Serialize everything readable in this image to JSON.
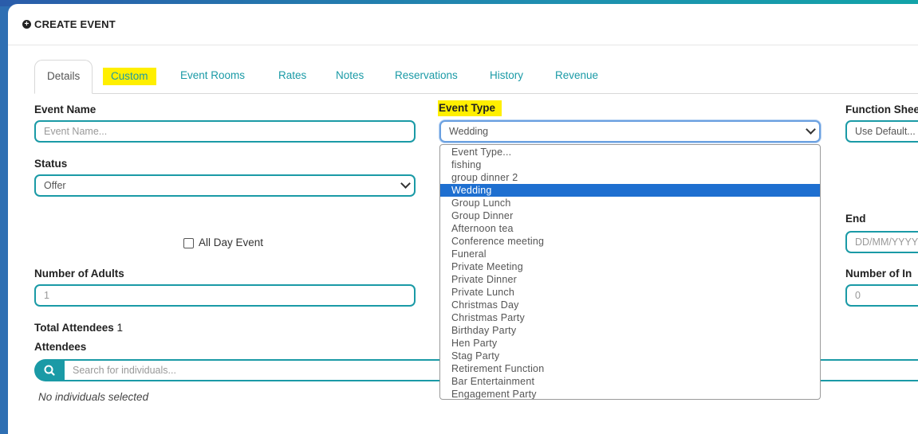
{
  "header": {
    "title": "CREATE EVENT"
  },
  "tabs": [
    "Details",
    "Custom",
    "Event Rooms",
    "Rates",
    "Notes",
    "Reservations",
    "History",
    "Revenue"
  ],
  "form": {
    "event_name": {
      "label": "Event Name",
      "placeholder": "Event Name..."
    },
    "event_type": {
      "label": "Event Type",
      "value": "Wedding"
    },
    "function_sheet": {
      "label": "Function Shee",
      "value": "Use Default..."
    },
    "status": {
      "label": "Status",
      "value": "Offer"
    },
    "all_day": {
      "label": "All Day Event",
      "checked": false
    },
    "end": {
      "label": "End",
      "placeholder": "DD/MM/YYYY"
    },
    "adults": {
      "label": "Number of Adults",
      "value": "1"
    },
    "infants": {
      "label": "Number of In",
      "value": "0"
    },
    "total_attendees": {
      "label": "Total Attendees",
      "value": "1"
    },
    "attendees": {
      "label": "Attendees",
      "search_placeholder": "Search for individuals...",
      "empty_text": "No individuals selected"
    }
  },
  "event_type_options": [
    "Event Type...",
    "fishing",
    "group dinner 2",
    "Wedding",
    "Group Lunch",
    "Group Dinner",
    "Afternoon tea",
    "Conference meeting",
    "Funeral",
    "Private Meeting",
    "Private Dinner",
    "Private Lunch",
    "Christmas Day",
    "Christmas Party",
    "Birthday Party",
    "Hen Party",
    "Stag Party",
    "Retirement Function",
    "Bar Entertainment",
    "Engagement Party"
  ],
  "selected_option": "Wedding",
  "colors": {
    "accent": "#1a9aa6",
    "highlight": "#ffef00",
    "selection": "#1e6fd0"
  }
}
